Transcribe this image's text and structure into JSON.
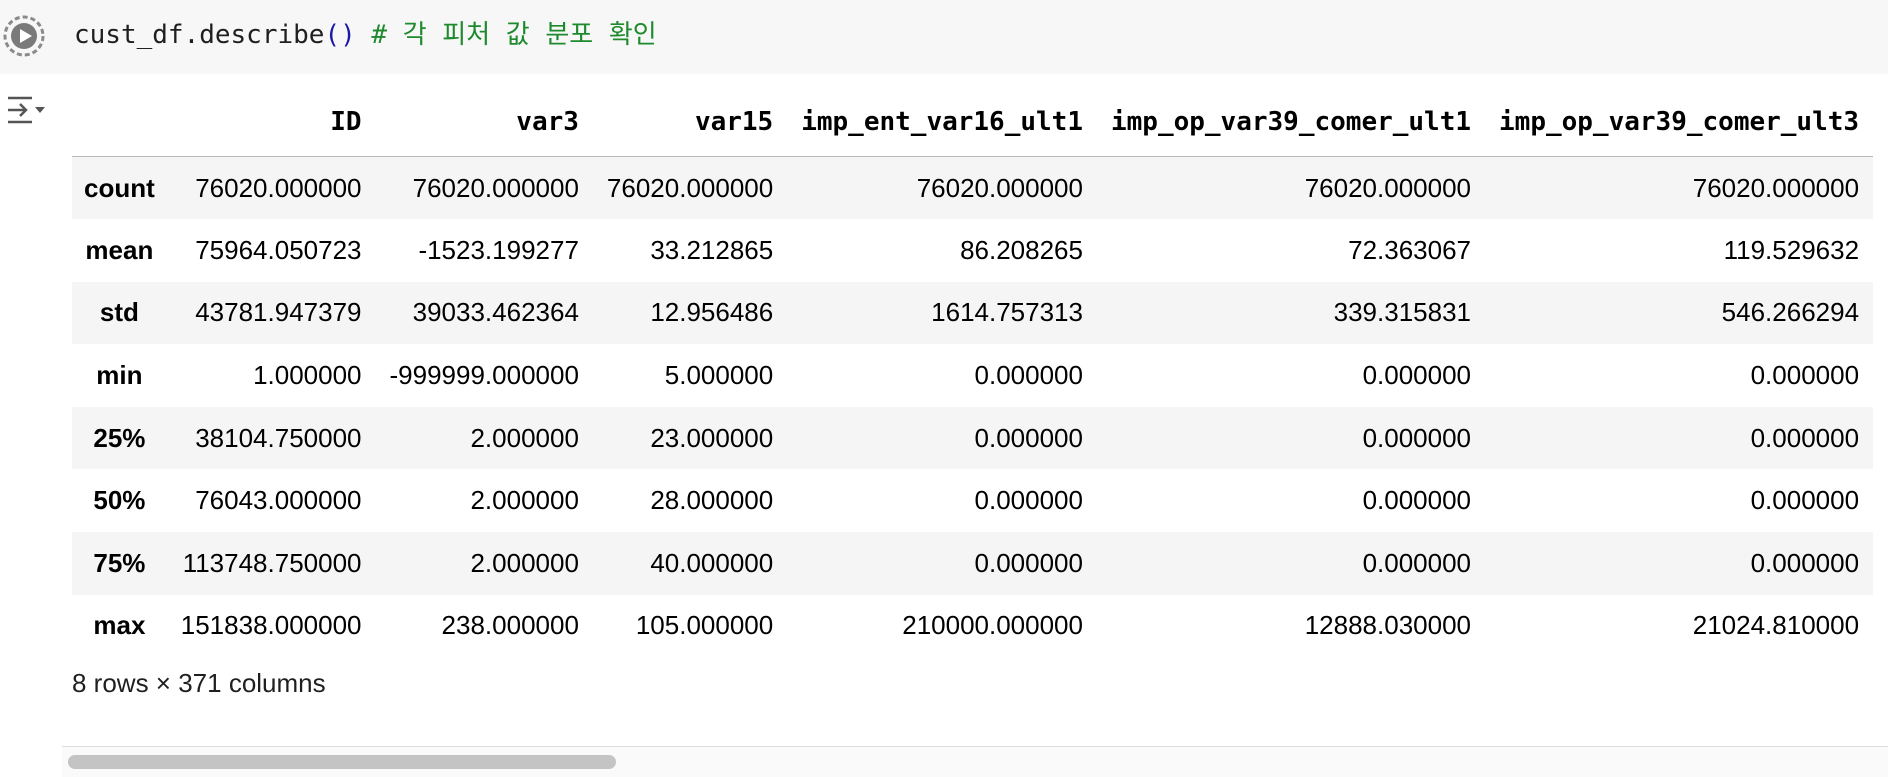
{
  "code_cell": {
    "code": "cust_df.describe",
    "paren": "()",
    "comment": " # 각 피처 값 분포 확인"
  },
  "icons": {
    "run": "play-circle-icon",
    "output_toggle": "collapse-output-icon"
  },
  "table": {
    "columns": [
      "ID",
      "var3",
      "var15",
      "imp_ent_var16_ult1",
      "imp_op_var39_comer_ult1",
      "imp_op_var39_comer_ult3"
    ],
    "rows": [
      {
        "label": "count",
        "values": [
          "76020.000000",
          "76020.000000",
          "76020.000000",
          "76020.000000",
          "76020.000000",
          "76020.000000"
        ]
      },
      {
        "label": "mean",
        "values": [
          "75964.050723",
          "-1523.199277",
          "33.212865",
          "86.208265",
          "72.363067",
          "119.529632"
        ]
      },
      {
        "label": "std",
        "values": [
          "43781.947379",
          "39033.462364",
          "12.956486",
          "1614.757313",
          "339.315831",
          "546.266294"
        ]
      },
      {
        "label": "min",
        "values": [
          "1.000000",
          "-999999.000000",
          "5.000000",
          "0.000000",
          "0.000000",
          "0.000000"
        ]
      },
      {
        "label": "25%",
        "values": [
          "38104.750000",
          "2.000000",
          "23.000000",
          "0.000000",
          "0.000000",
          "0.000000"
        ]
      },
      {
        "label": "50%",
        "values": [
          "76043.000000",
          "2.000000",
          "28.000000",
          "0.000000",
          "0.000000",
          "0.000000"
        ]
      },
      {
        "label": "75%",
        "values": [
          "113748.750000",
          "2.000000",
          "40.000000",
          "0.000000",
          "0.000000",
          "0.000000"
        ]
      },
      {
        "label": "max",
        "values": [
          "151838.000000",
          "238.000000",
          "105.000000",
          "210000.000000",
          "12888.030000",
          "21024.810000"
        ]
      }
    ]
  },
  "shape_note": "8 rows × 371 columns",
  "colors": {
    "comment": "#1e8a2e",
    "paren": "#1a1aa6",
    "row_stripe": "#f5f5f5"
  }
}
